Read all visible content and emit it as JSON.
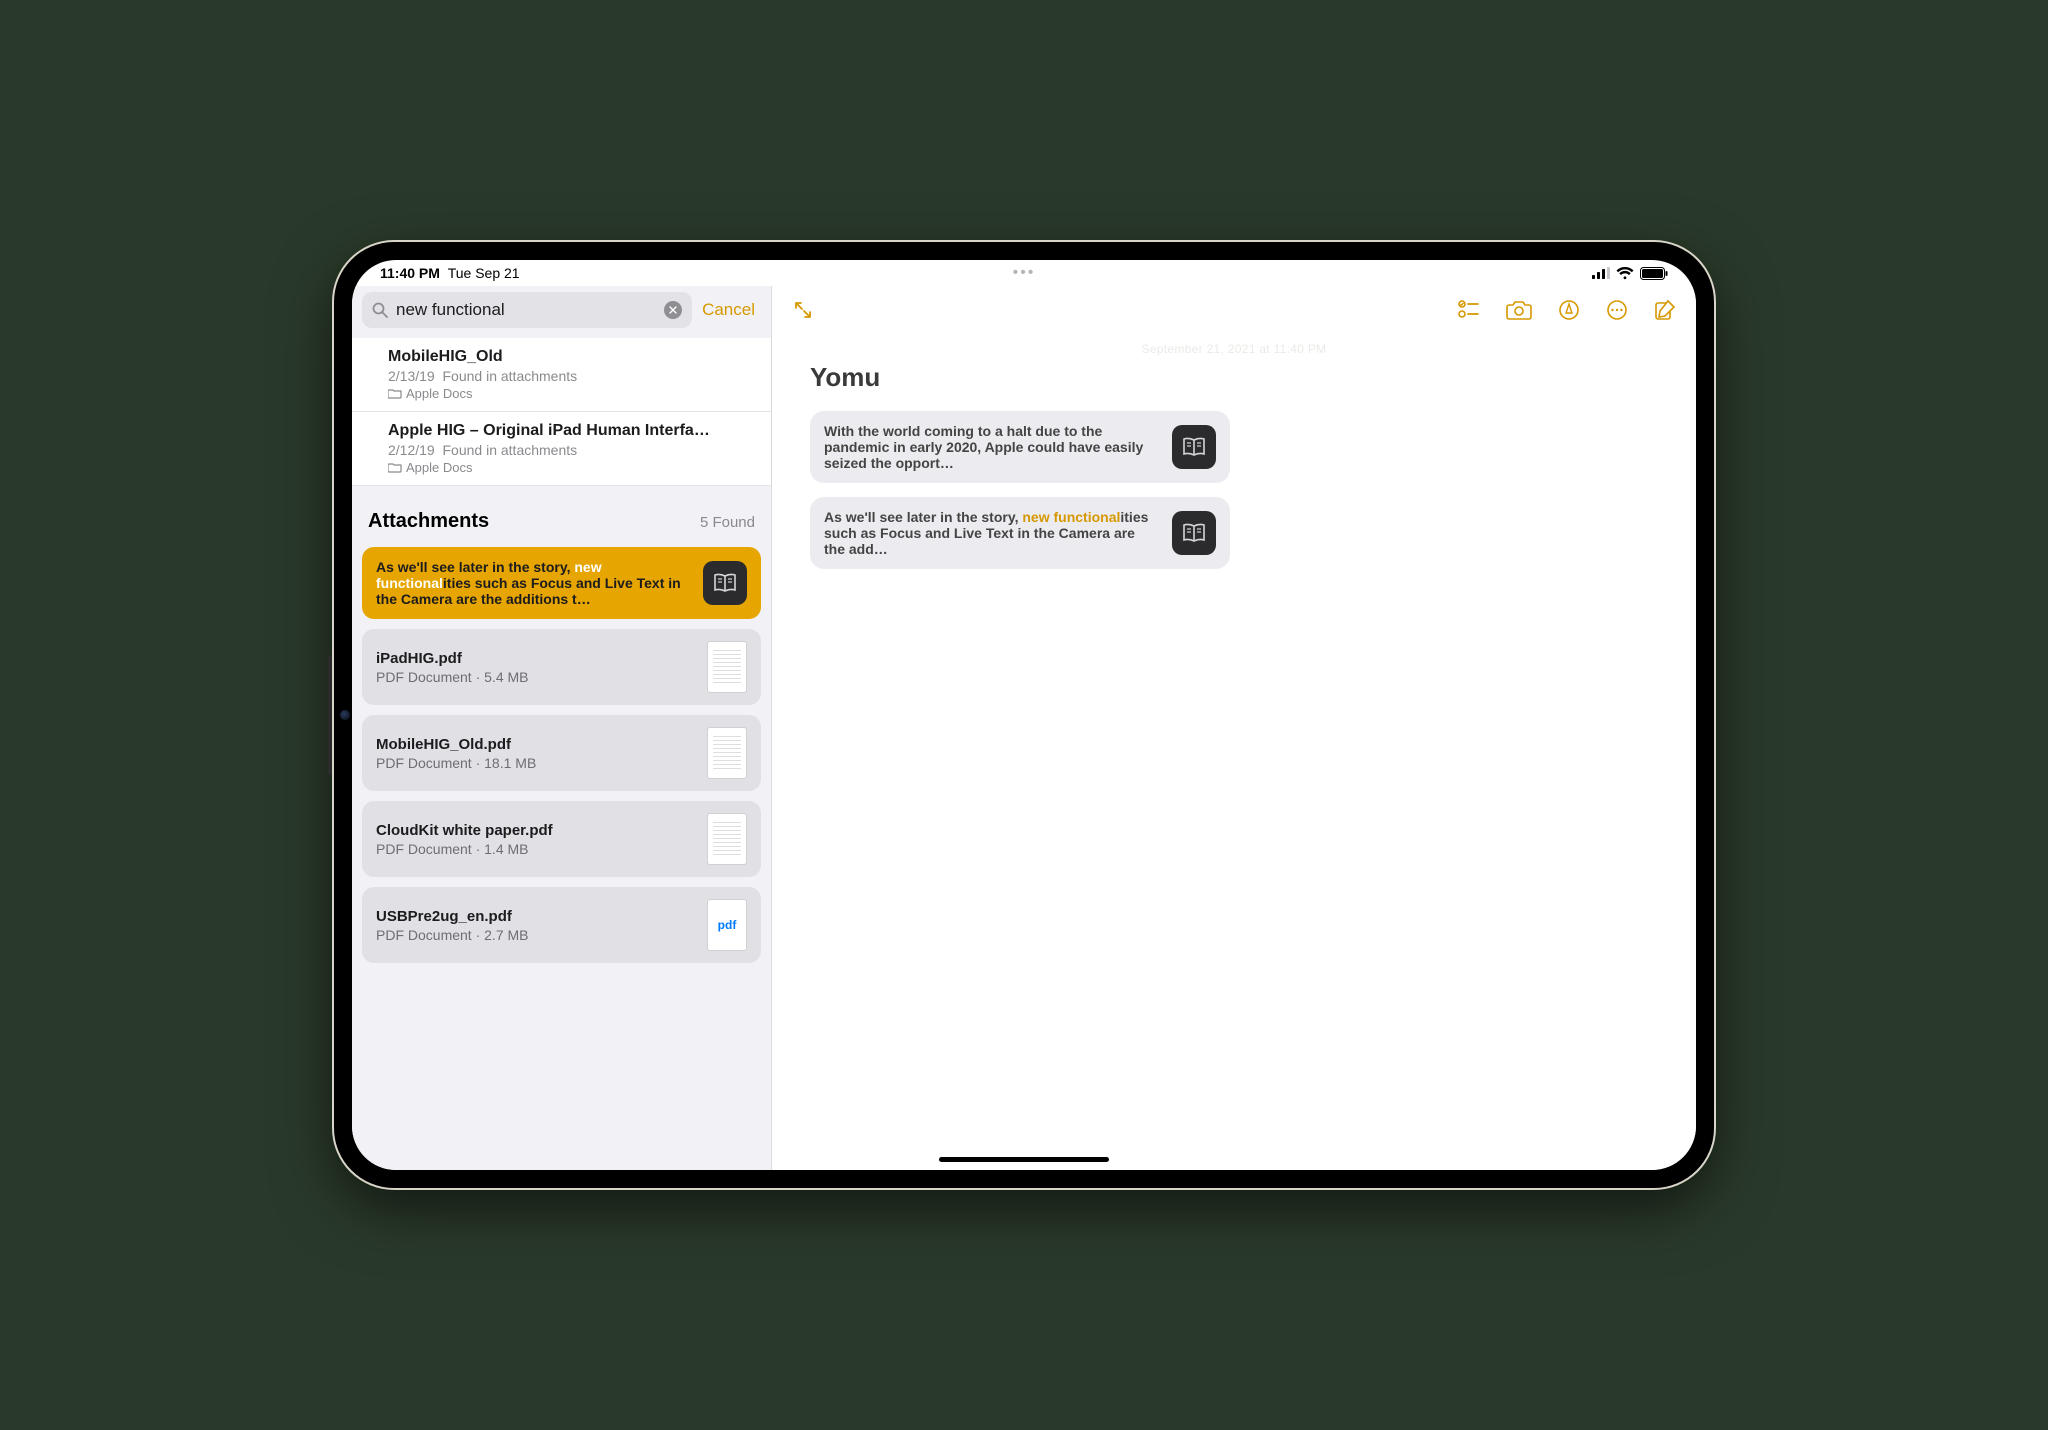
{
  "status": {
    "time": "11:40 PM",
    "date": "Tue Sep 21"
  },
  "search": {
    "value": "new functional",
    "cancel_label": "Cancel"
  },
  "note_results": [
    {
      "title": "MobileHIG_Old",
      "sub_date": "2/13/19",
      "sub_loc": "Found in attachments",
      "folder": "Apple Docs"
    },
    {
      "title": "Apple HIG – Original iPad Human Interfa…",
      "sub_date": "2/12/19",
      "sub_loc": "Found in attachments",
      "folder": "Apple Docs"
    }
  ],
  "attachments": {
    "header": "Attachments",
    "count": "5 Found",
    "items": [
      {
        "kind": "snippet",
        "selected": true,
        "pre": "As we'll see later in the story, ",
        "highlight": "new functional",
        "post": "ities such as Focus and Live Text in the Camera are the additions t…"
      },
      {
        "kind": "pdf",
        "title": "iPadHIG.pdf",
        "meta": "PDF Document · 5.4 MB",
        "thumb": "lines"
      },
      {
        "kind": "pdf",
        "title": "MobileHIG_Old.pdf",
        "meta": "PDF Document · 18.1 MB",
        "thumb": "lines"
      },
      {
        "kind": "pdf",
        "title": "CloudKit white paper.pdf",
        "meta": "PDF Document · 1.4 MB",
        "thumb": "lines"
      },
      {
        "kind": "pdf",
        "title": "USBPre2ug_en.pdf",
        "meta": "PDF Document · 2.7 MB",
        "thumb": "label",
        "thumb_label": "pdf"
      }
    ]
  },
  "note": {
    "date": "September 21, 2021 at 11:40 PM",
    "title": "Yomu",
    "cards": [
      {
        "pre": "With the world coming to a halt due to the pandemic in early 2020, Apple could have easily seized the opport…",
        "highlight": "",
        "post": ""
      },
      {
        "pre": "As we'll see later in the story, ",
        "highlight": "new functional",
        "post": "ities such as Focus and Live Text in the Camera are the add…"
      }
    ]
  }
}
